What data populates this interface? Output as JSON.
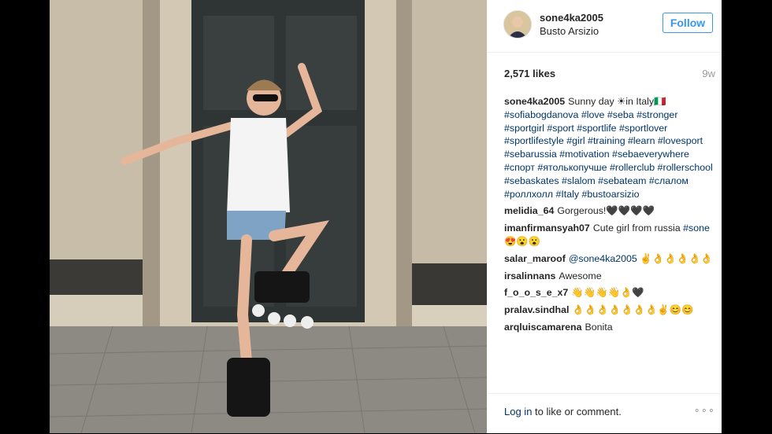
{
  "post": {
    "username": "sone4ka2005",
    "location": "Busto Arsizio",
    "follow_label": "Follow",
    "likes": "2,571 likes",
    "age": "9w"
  },
  "caption": {
    "user": "sone4ka2005",
    "text": "Sunny day ☀in Italy🇮🇹",
    "hashtags": "#sofiabogdanova #love #seba #stronger #sportgirl #sport #sportlife #sportlover #sportlifestyle #girl #training #learn #lovesport #sebarussia #motivation #sebaeverywhere #спорт #ятолькопучше #rollerclub #rollerschool #sebaskates #slalom #sebateam #слалом #роллхолл #Italy #bustoarsizio"
  },
  "comments": [
    {
      "user": "melidia_64",
      "text": "Gorgerous!🖤🖤🖤🖤"
    },
    {
      "user": "imanfirmansyah07",
      "text": "Cute girl from russia ",
      "tag": "#sone",
      "after": " 😍😮😮"
    },
    {
      "user": "salar_maroof",
      "mention": "@sone4ka2005",
      "text": " ✌👌👌👌👌👌"
    },
    {
      "user": "irsalinnans",
      "text": "Awesome"
    },
    {
      "user": "f_o_o_s_e_x7",
      "text": "👋👋👋👋👌🖤"
    },
    {
      "user": "pralav.sindhal",
      "text": "👌👌👌👌👌👌👌✌😊😊"
    },
    {
      "user": "arqluiscamarena",
      "text": "Bonita"
    }
  ],
  "footer": {
    "login_link": "Log in",
    "login_rest": " to like or comment.",
    "more_icon": "ellipsis-icon"
  },
  "colors": {
    "link": "#003569",
    "follow_blue": "#3897f0",
    "muted": "#999999"
  }
}
